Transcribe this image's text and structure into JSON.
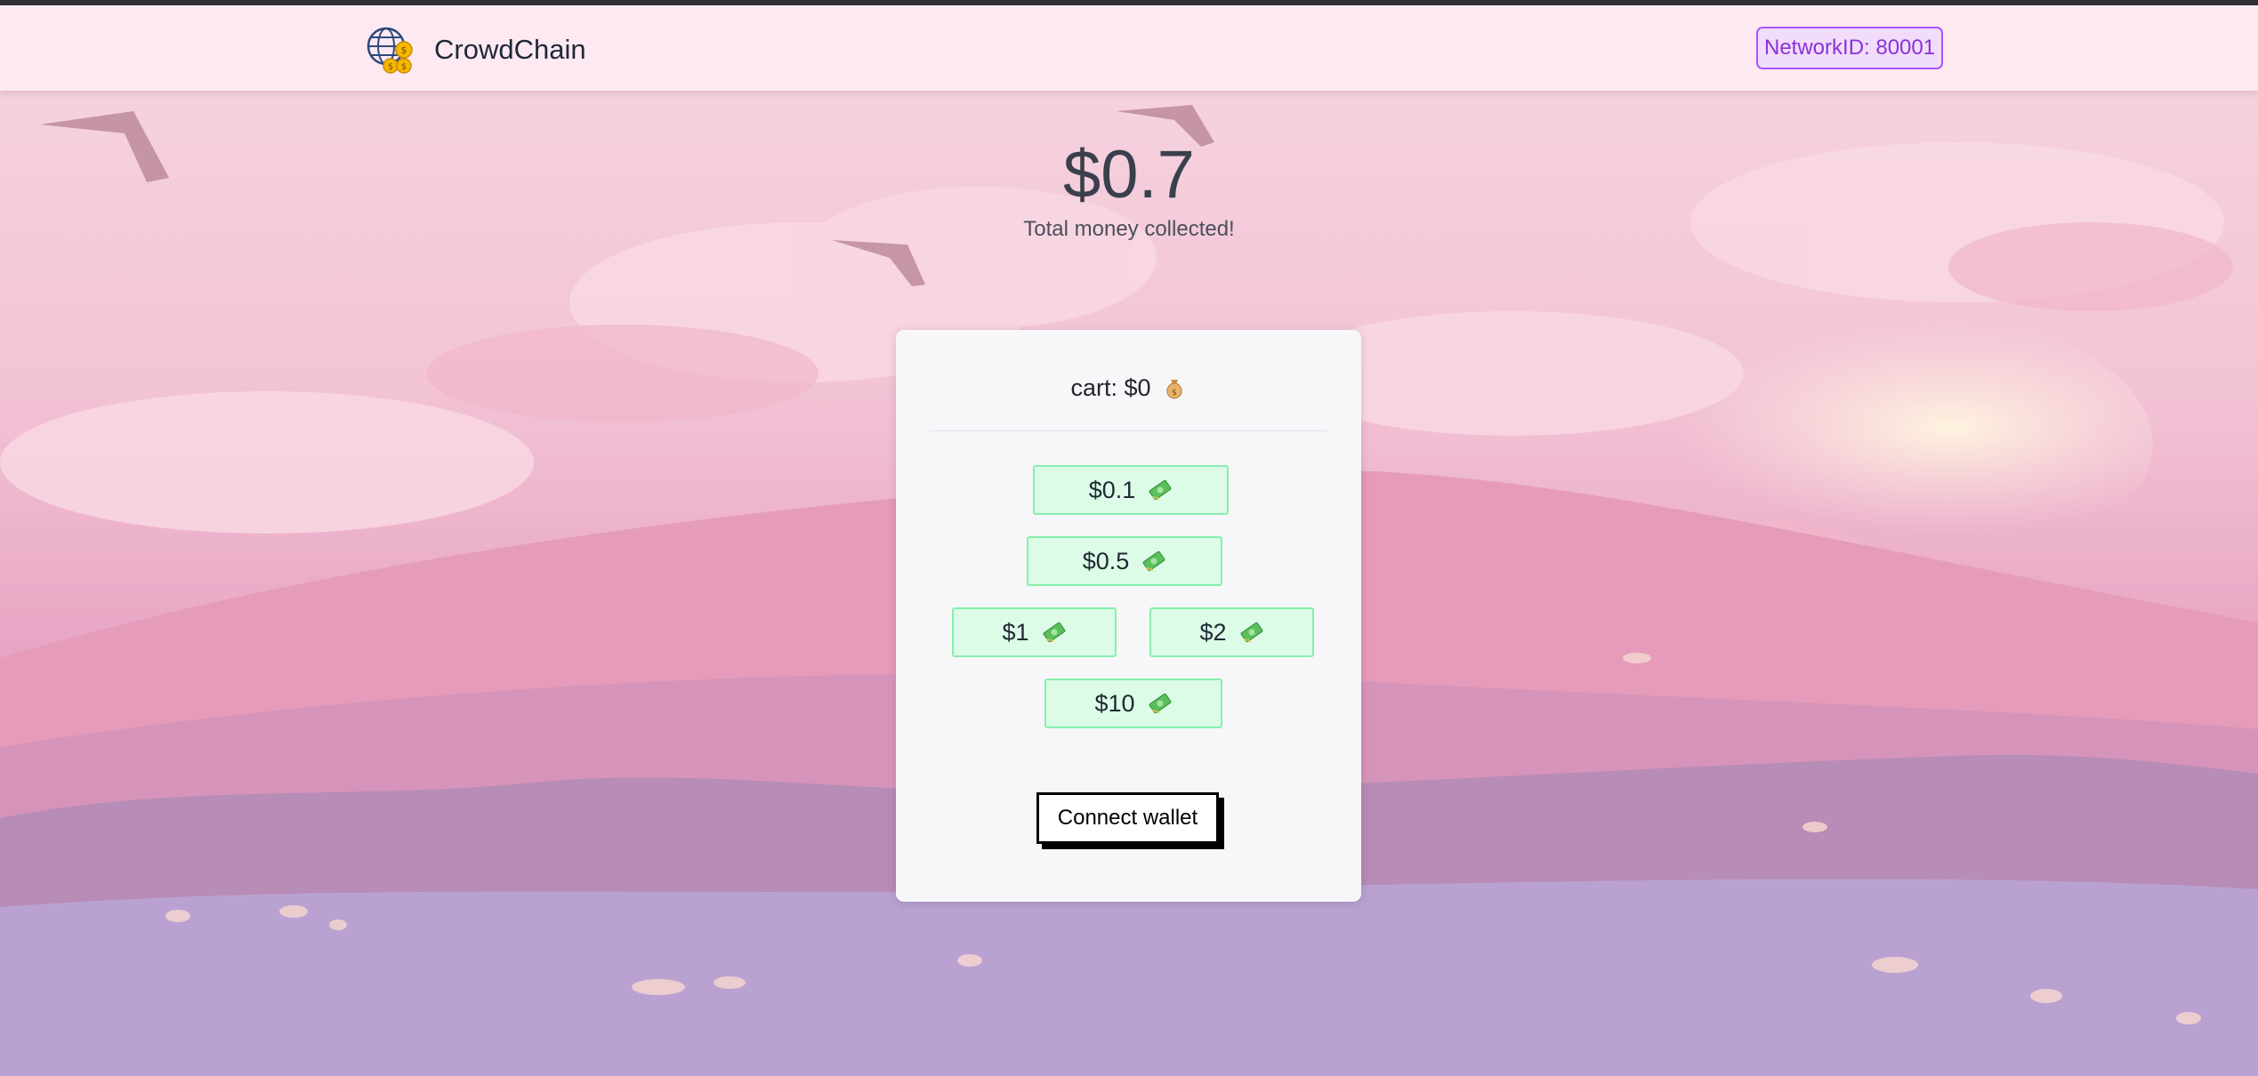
{
  "navbar": {
    "brand_name": "CrowdChain",
    "network_badge": "NetworkID: 80001"
  },
  "summary": {
    "total_amount": "$0.7",
    "total_label": "Total money collected!"
  },
  "cart": {
    "label": "cart: $0",
    "icon": "money-bag-icon"
  },
  "donation_options": [
    {
      "label": "$0.1",
      "icon": "banknote-icon"
    },
    {
      "label": "$0.5",
      "icon": "banknote-icon"
    },
    {
      "label": "$1",
      "icon": "banknote-icon"
    },
    {
      "label": "$2",
      "icon": "banknote-icon"
    },
    {
      "label": "$10",
      "icon": "banknote-icon"
    }
  ],
  "actions": {
    "connect_wallet_label": "Connect wallet"
  },
  "colors": {
    "navbar_background": "#fde9f2",
    "badge_border": "#a855f7",
    "badge_text": "#8b32d8",
    "amount_button_background": "#dcfce7",
    "amount_button_border": "#86efac",
    "card_background": "#f7f7fa"
  }
}
